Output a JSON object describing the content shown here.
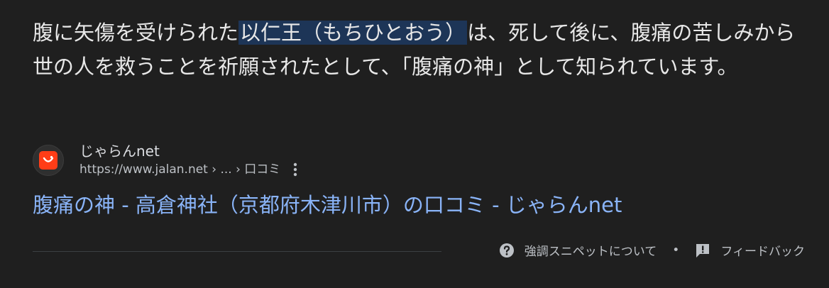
{
  "snippet": {
    "before": "腹に矢傷を受けられた",
    "highlight": "以仁王（もちひとおう）",
    "after": "は、死して後に、腹痛の苦しみから世の人を救うことを祈願されたとして、「腹痛の神」として知られています。"
  },
  "source": {
    "favicon": "jalan-smile-icon",
    "site_name": "じゃらんnet",
    "url": "https://www.jalan.net › ... › 口コミ",
    "more_icon": "three-dots-vertical-icon"
  },
  "result": {
    "title": "腹痛の神 - 高倉神社（京都府木津川市）の口コミ - じゃらんnet"
  },
  "footer": {
    "about_label": "強調スニペットについて",
    "separator": "•",
    "feedback_label": "フィードバック",
    "about_icon": "question-circle-icon",
    "feedback_icon": "feedback-icon"
  },
  "colors": {
    "background": "#1f1f1f",
    "highlight": "#1d3557",
    "link": "#8ab4f8",
    "favicon_brand": "#ff3d17"
  }
}
